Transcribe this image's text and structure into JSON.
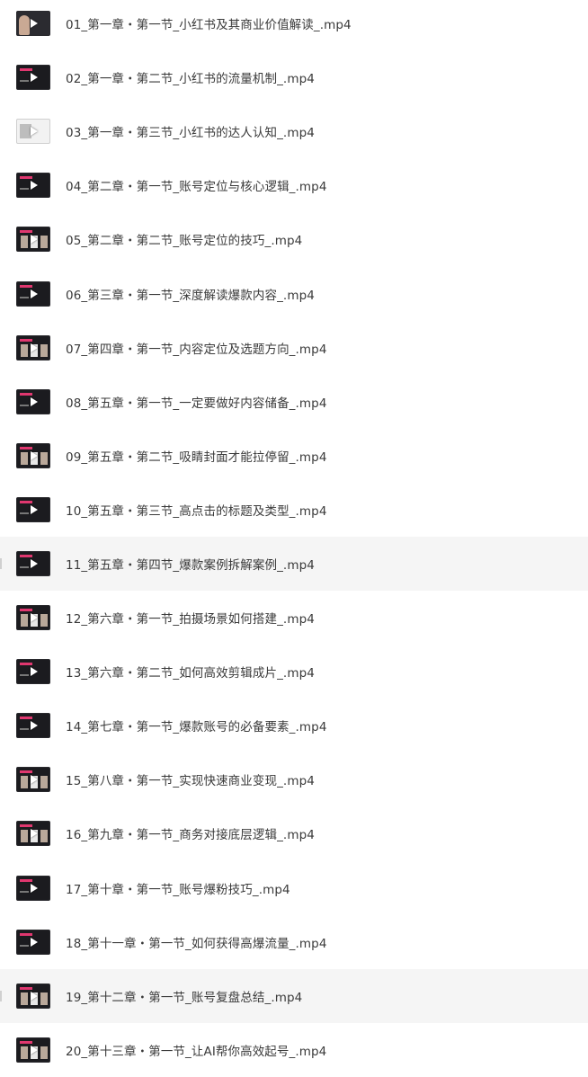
{
  "files": [
    {
      "name": "01_第一章・第一节_小红书及其商业价值解读_.mp4",
      "thumb_style": "portrait",
      "highlighted": false
    },
    {
      "name": "02_第一章・第二节_小红书的流量机制_.mp4",
      "thumb_style": "dark",
      "highlighted": false
    },
    {
      "name": "03_第一章・第三节_小红书的达人认知_.mp4",
      "thumb_style": "light",
      "highlighted": false
    },
    {
      "name": "04_第二章・第一节_账号定位与核心逻辑_.mp4",
      "thumb_style": "dark",
      "highlighted": false
    },
    {
      "name": "05_第二章・第二节_账号定位的技巧_.mp4",
      "thumb_style": "panels",
      "highlighted": false
    },
    {
      "name": "06_第三章・第一节_深度解读爆款内容_.mp4",
      "thumb_style": "dark",
      "highlighted": false
    },
    {
      "name": "07_第四章・第一节_内容定位及选题方向_.mp4",
      "thumb_style": "panels",
      "highlighted": false
    },
    {
      "name": "08_第五章・第一节_一定要做好内容储备_.mp4",
      "thumb_style": "dark",
      "highlighted": false
    },
    {
      "name": "09_第五章・第二节_吸睛封面才能拉停留_.mp4",
      "thumb_style": "panels",
      "highlighted": false
    },
    {
      "name": "10_第五章・第三节_高点击的标题及类型_.mp4",
      "thumb_style": "dark",
      "highlighted": false
    },
    {
      "name": "11_第五章・第四节_爆款案例拆解案例_.mp4",
      "thumb_style": "dark",
      "highlighted": true
    },
    {
      "name": "12_第六章・第一节_拍摄场景如何搭建_.mp4",
      "thumb_style": "panels",
      "highlighted": false
    },
    {
      "name": "13_第六章・第二节_如何高效剪辑成片_.mp4",
      "thumb_style": "dark",
      "highlighted": false
    },
    {
      "name": "14_第七章・第一节_爆款账号的必备要素_.mp4",
      "thumb_style": "dark",
      "highlighted": false
    },
    {
      "name": "15_第八章・第一节_实现快速商业变现_.mp4",
      "thumb_style": "panels",
      "highlighted": false
    },
    {
      "name": "16_第九章・第一节_商务对接底层逻辑_.mp4",
      "thumb_style": "panels",
      "highlighted": false
    },
    {
      "name": "17_第十章・第一节_账号爆粉技巧_.mp4",
      "thumb_style": "dark",
      "highlighted": false
    },
    {
      "name": "18_第十一章・第一节_如何获得高爆流量_.mp4",
      "thumb_style": "dark",
      "highlighted": false
    },
    {
      "name": "19_第十二章・第一节_账号复盘总结_.mp4",
      "thumb_style": "panels",
      "highlighted": true
    },
    {
      "name": "20_第十三章・第一节_让AI帮你高效起号_.mp4",
      "thumb_style": "panels",
      "highlighted": false
    }
  ],
  "colors": {
    "text": "#3a3a3a",
    "row_highlight": "#f5f5f5",
    "thumb_dark": "#1b1b1f",
    "thumb_accent": "#e0376f"
  },
  "icons": {
    "file_thumbnail": "video-thumbnail-icon",
    "play": "play-icon"
  }
}
